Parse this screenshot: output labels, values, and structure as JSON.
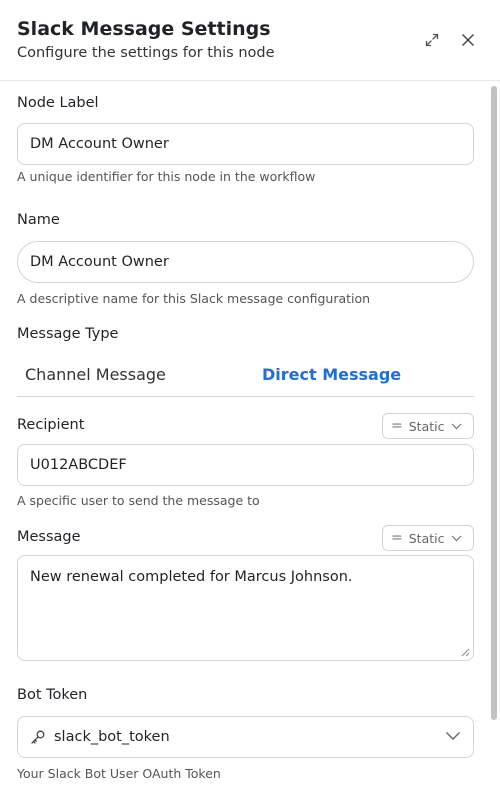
{
  "header": {
    "title": "Slack Message Settings",
    "subtitle": "Configure the settings for this node"
  },
  "icons": {
    "expand": "expand-icon",
    "close": "close-icon",
    "key": "key-icon",
    "chevron": "chevron-down-icon"
  },
  "form": {
    "node_label": {
      "label": "Node Label",
      "value": "DM Account Owner",
      "help": "A unique identifier for this node in the workflow"
    },
    "name": {
      "label": "Name",
      "value": "DM Account Owner",
      "help": "A descriptive name for this Slack message configuration"
    },
    "message_type": {
      "label": "Message Type",
      "tabs": [
        "Channel Message",
        "Direct Message"
      ],
      "active": "Direct Message"
    },
    "recipient": {
      "label": "Recipient",
      "mode": "Static",
      "value": "U012ABCDEF",
      "help": "A specific user to send the message to"
    },
    "message": {
      "label": "Message",
      "mode": "Static",
      "value": "New renewal completed for Marcus Johnson."
    },
    "bot_token": {
      "label": "Bot Token",
      "value": "slack_bot_token",
      "help": "Your Slack Bot User OAuth Token"
    }
  },
  "colors": {
    "accent": "#1f6fd6",
    "border": "#d4d4d8",
    "text": "#1f2328"
  }
}
